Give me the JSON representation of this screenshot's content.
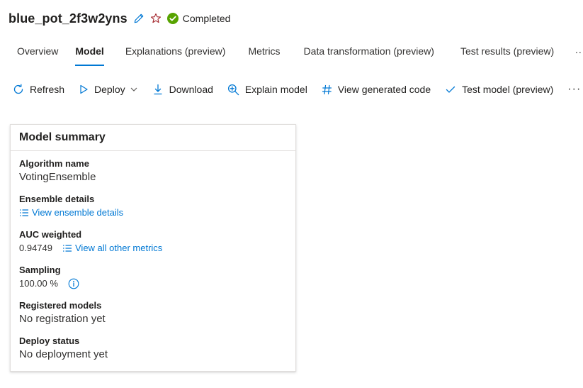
{
  "header": {
    "title": "blue_pot_2f3w2yns",
    "edit_icon": "pencil-icon",
    "favorite_icon": "star-icon",
    "status": "Completed",
    "status_color": "#57a300"
  },
  "tabs": [
    {
      "label": "Overview",
      "active": false
    },
    {
      "label": "Model",
      "active": true
    },
    {
      "label": "Explanations (preview)",
      "active": false
    },
    {
      "label": "Metrics",
      "active": false
    },
    {
      "label": "Data transformation (preview)",
      "active": false
    },
    {
      "label": "Test results (preview)",
      "active": false
    }
  ],
  "tabs_more": "...",
  "toolbar": {
    "refresh": "Refresh",
    "deploy": "Deploy",
    "download": "Download",
    "explain_model": "Explain model",
    "view_code": "View generated code",
    "test_model": "Test model (preview)",
    "more": "···"
  },
  "accent_color": "#0078d4",
  "summary": {
    "title": "Model summary",
    "algorithm_label": "Algorithm name",
    "algorithm_value": "VotingEnsemble",
    "ensemble_label": "Ensemble details",
    "ensemble_link": "View ensemble details",
    "auc_label": "AUC weighted",
    "auc_value": "0.94749",
    "metrics_link": "View all other metrics",
    "sampling_label": "Sampling",
    "sampling_value": "100.00 %",
    "registered_label": "Registered models",
    "registered_value": "No registration yet",
    "deploy_label": "Deploy status",
    "deploy_value": "No deployment yet"
  }
}
